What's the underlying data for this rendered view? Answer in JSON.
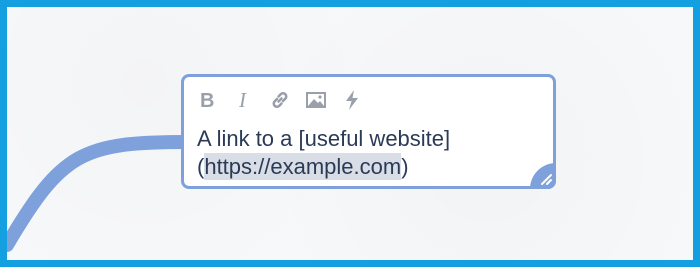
{
  "node": {
    "line1": "A link to a [useful website]",
    "paren_open": "(",
    "url": "https://example.com",
    "paren_close": ")"
  },
  "toolbar": {
    "items": [
      {
        "icon": "bold-icon"
      },
      {
        "icon": "italic-icon"
      },
      {
        "icon": "link-icon"
      },
      {
        "icon": "image-icon"
      },
      {
        "icon": "lightning-icon"
      }
    ]
  },
  "colors": {
    "frame_border": "#139fe0",
    "node_border": "#7ea0db",
    "connector": "#7ea0db",
    "text": "#2b3b57",
    "icon": "#9aa0aa",
    "url_highlight": "#d9dde6"
  }
}
